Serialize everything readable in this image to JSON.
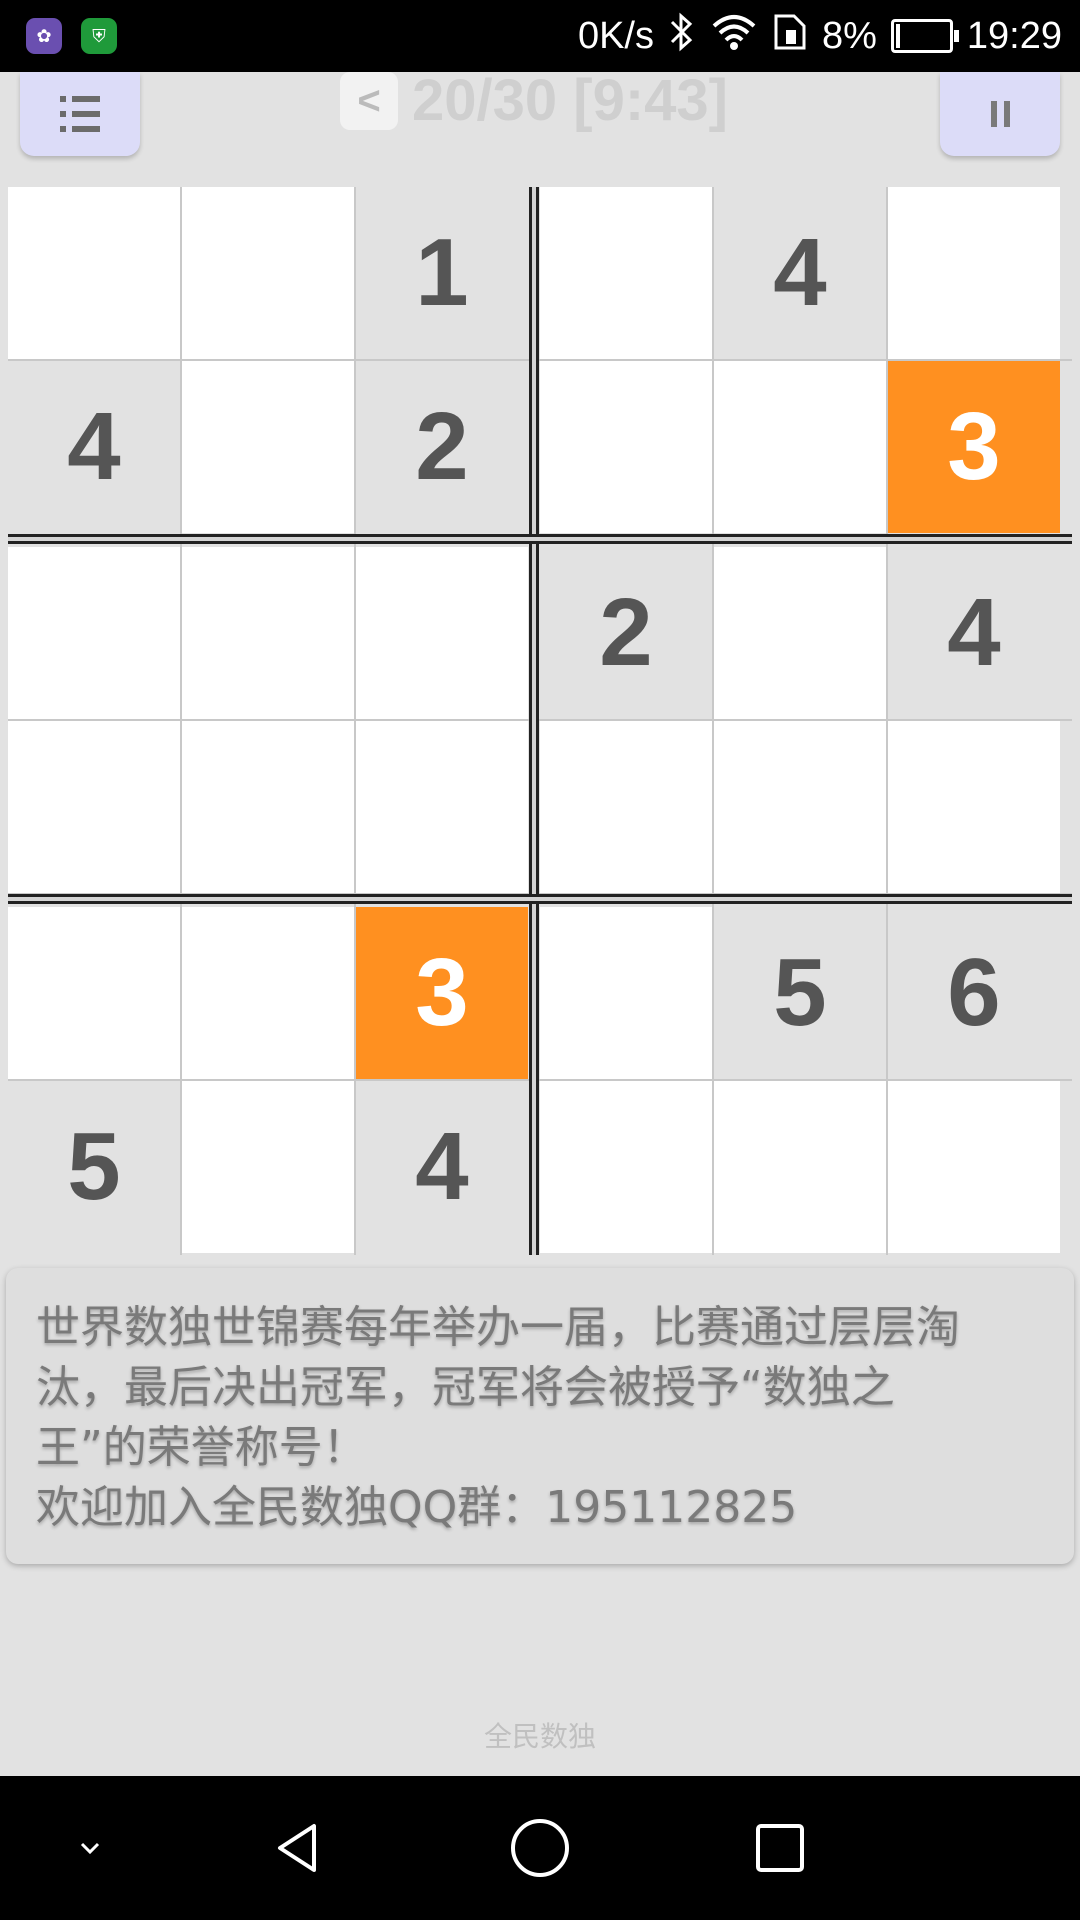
{
  "status_bar": {
    "net_speed": "0K/s",
    "battery": "8%",
    "battery_level": 0.08,
    "time": "19:29",
    "app_icons": [
      "huawei-assistant-icon",
      "phone-manager-icon"
    ],
    "system_icons": [
      "bluetooth-icon",
      "wifi-icon",
      "sim-icon",
      "battery-icon"
    ]
  },
  "header": {
    "menu_icon": "list-icon",
    "back_label": "<",
    "progress": "20/30 [9:43]",
    "pause_icon": "pause-icon"
  },
  "board": {
    "size": 6,
    "cells": [
      [
        "",
        "",
        "1",
        "",
        "4",
        ""
      ],
      [
        "4",
        "",
        "2",
        "",
        "",
        "3"
      ],
      [
        "",
        "",
        "",
        "2",
        "",
        "4"
      ],
      [
        "",
        "",
        "",
        "",
        "",
        ""
      ],
      [
        "",
        "",
        "3",
        "",
        "5",
        "6"
      ],
      [
        "5",
        "",
        "4",
        "",
        "",
        ""
      ]
    ],
    "highlighted": [
      [
        1,
        5
      ],
      [
        4,
        2
      ]
    ],
    "highlight_color": "#ff9020",
    "given_color": "#e2e2e2",
    "empty_color": "#ffffff"
  },
  "info": {
    "line1": "世界数独世锦赛每年举办一届，比赛通过层层淘",
    "line2": "汰，最后决出冠军，冠军将会被授予“数独之",
    "line3": "王”的荣誉称号！",
    "line4": "欢迎加入全民数独QQ群：195112825"
  },
  "footer": {
    "app_name": "全民数独"
  },
  "nav_bar": {
    "icons": [
      "collapse-icon",
      "back-icon",
      "home-icon",
      "recents-icon"
    ]
  }
}
